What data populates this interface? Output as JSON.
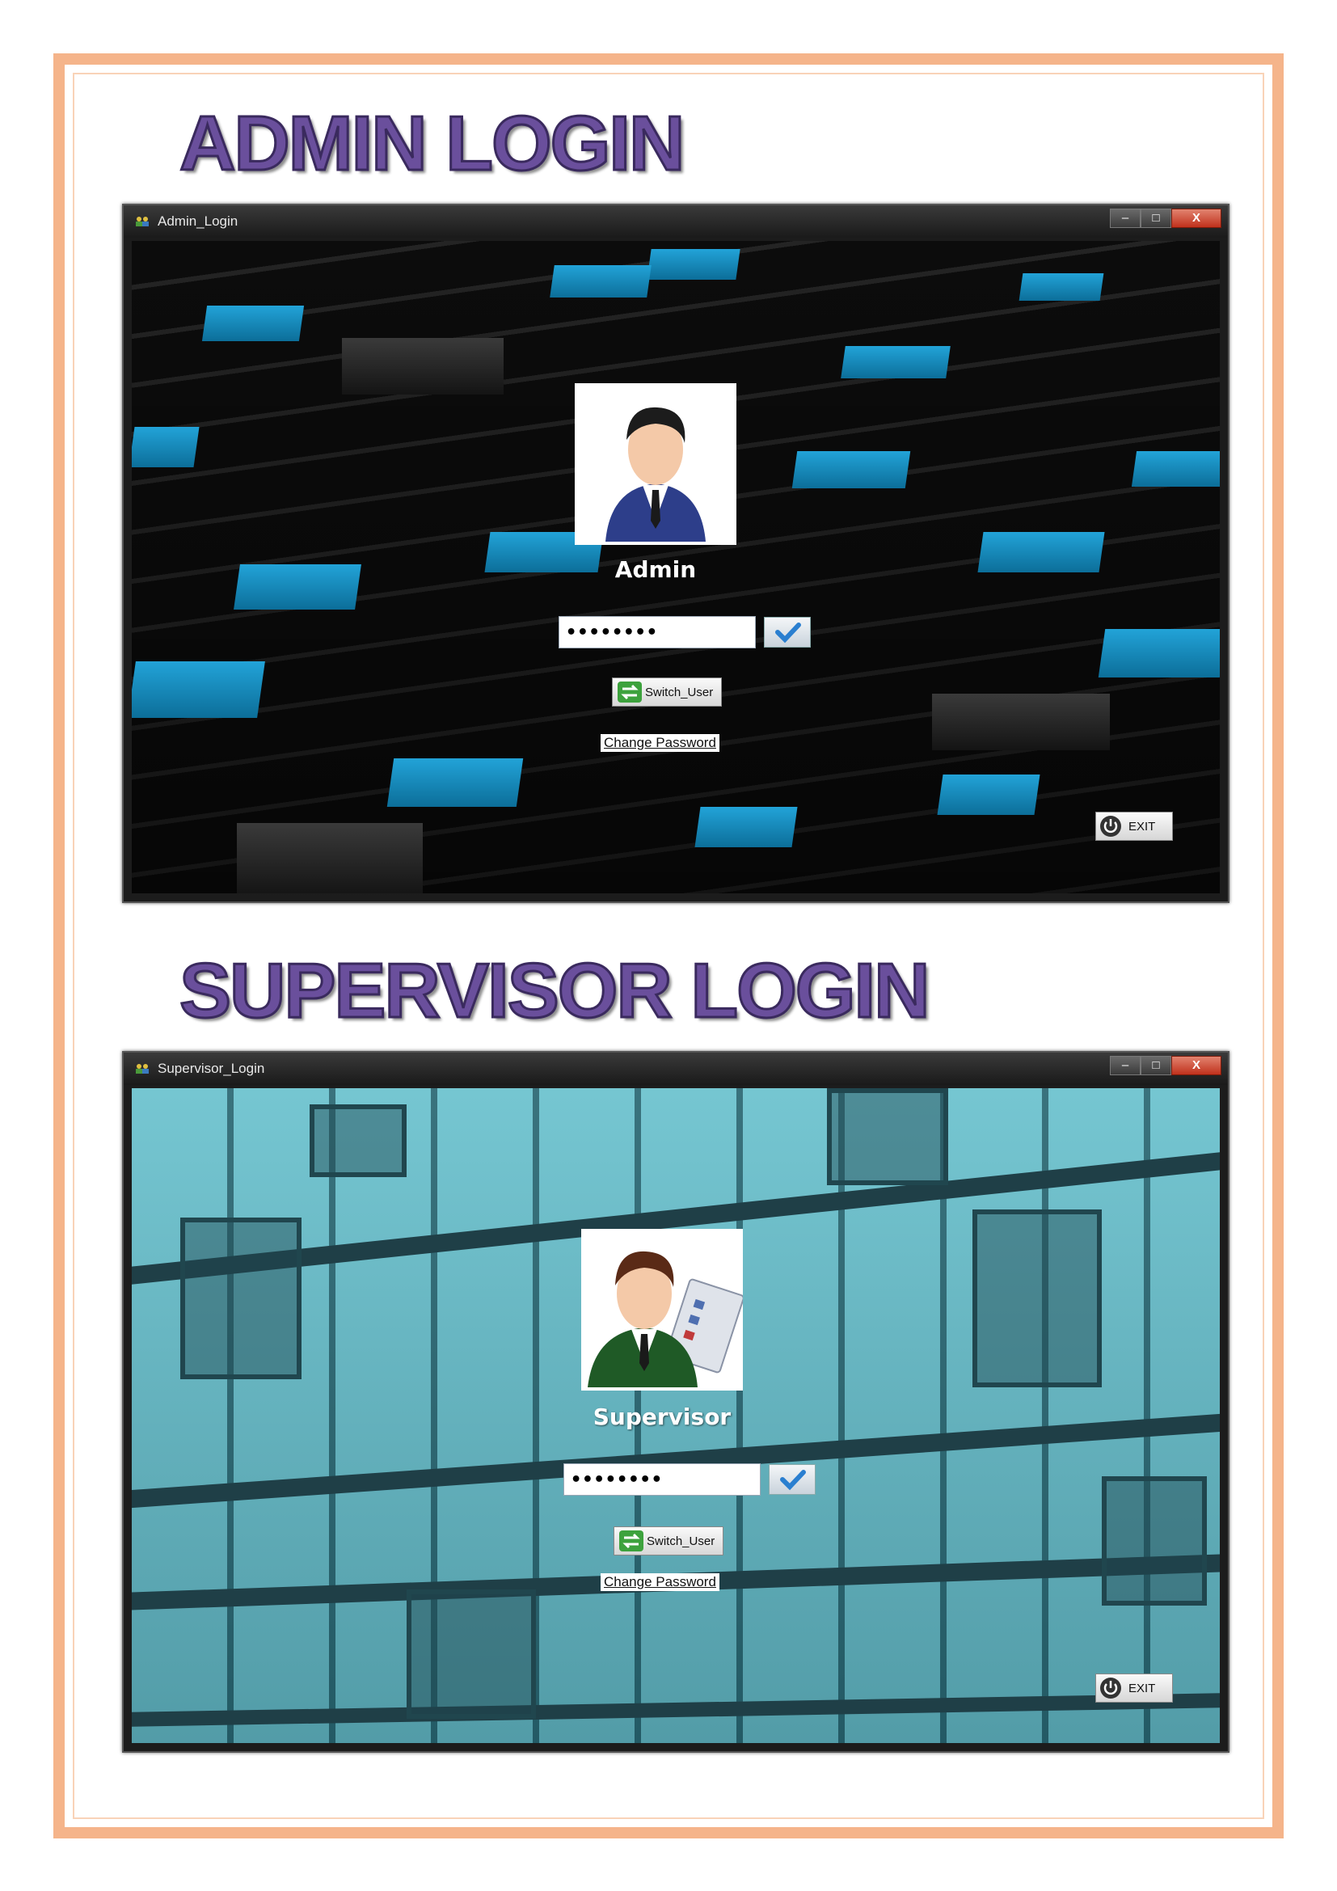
{
  "headings": {
    "admin": "ADMIN LOGIN",
    "supervisor": "SUPERVISOR LOGIN"
  },
  "admin_window": {
    "title": "Admin_Login",
    "controls": {
      "minimize": "–",
      "maximize": "□",
      "close": "X"
    },
    "user_label": "Admin",
    "password_value": "••••••••",
    "submit_icon": "checkmark-icon",
    "switch_user_label": "Switch_User",
    "change_password_label": "Change Password",
    "exit_label": "EXIT",
    "background": "dark-blue-blocks"
  },
  "supervisor_window": {
    "title": "Supervisor_Login",
    "controls": {
      "minimize": "–",
      "maximize": "□",
      "close": "X"
    },
    "user_label": "Supervisor",
    "password_value": "••••••••",
    "submit_icon": "checkmark-icon",
    "switch_user_label": "Switch_User",
    "change_password_label": "Change Password",
    "exit_label": "EXIT",
    "background": "teal-video-wall"
  },
  "colors": {
    "frame": "#f5b48a",
    "heading": "#6a4f9c",
    "accent_blue": "#22a3d8",
    "teal": "#6ec3cf"
  }
}
